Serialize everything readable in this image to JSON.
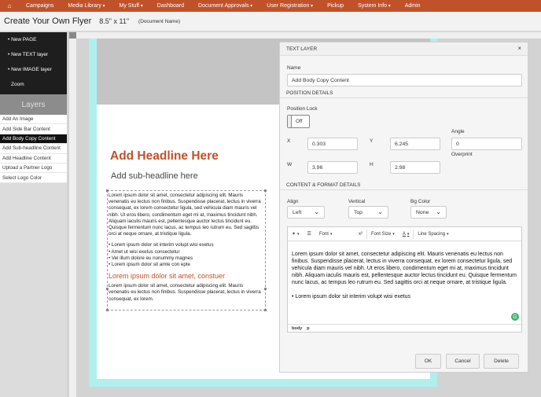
{
  "nav": {
    "home_icon": "⌂",
    "items": [
      "Campaigns",
      "Media Library",
      "My Stuff",
      "Dashboard",
      "Document Approvals",
      "User Registration",
      "Pickup",
      "System Info",
      "Admin"
    ]
  },
  "titlebar": {
    "title": "Create Your Own Flyer",
    "size": "8.5\" x 11\"",
    "docname": "(Document Name)"
  },
  "sidebar": {
    "actions": [
      "• New PAGE",
      "• New TEXT layer",
      "• New IMAGE layer",
      "Zoom"
    ],
    "layers_title": "Layers",
    "layers": [
      "Add An Image",
      "Add Side Bar Content",
      "Add Body Copy Content",
      "Add Sub-headline Content",
      "Add Headline Content",
      "Upload a Partner Logo",
      "Select Logo Color"
    ]
  },
  "canvas": {
    "headline": "Add Headline Here",
    "subheadline": "Add sub-headline here",
    "paragraph1": "Lorem ipsum dolor sit amet, consectetur adipiscing elit. Mauris venenatis eu lectus non finibus. Suspendisse placerat, lectus in viverra consequat, ex lorem consectetur ligula, sed vehicula diam mauris vel nibh. Ut eros libero, condimentum eget mi at, maximus tincidunt nibh. Aliquam iaculis mauris est, pellentesque auctor lectus tincidunt eu. Quisque fermentum nunc lacus, ac tempus leo rutrum eu. Sed sagittis orci at neque ornare, at tristique ligula.",
    "bullets": [
      "Lorem ipsum dolor sit interim volupt wisi exetus",
      "Amet ut wisi exetus consectetur",
      "Vel illum dolore eu nonummy magnes",
      "Lorem ipsum dolor sit amte con epte"
    ],
    "orange_heading": "Lorem ipsum dolor sit amet, constuer",
    "paragraph2": "Lorem ipsum dolor sit amet, consectetur adipiscing elit. Mauris venenatis eu lectus non finibus. Suspendisse placerat, lectus in viverra consequat, ex lorem."
  },
  "panel": {
    "title": "TEXT LAYER",
    "close": "×",
    "name_label": "Name",
    "name_value": "Add Body Copy Content",
    "position_section": "POSITION DETAILS",
    "position_lock_label": "Position Lock",
    "position_lock_value": "Off",
    "x_label": "X",
    "x_value": "0.303",
    "y_label": "Y",
    "y_value": "6.245",
    "angle_label": "Angle",
    "angle_value": "0",
    "overprint_label": "Overprint",
    "w_label": "W",
    "w_value": "3.96",
    "h_label": "H",
    "h_value": "2.98",
    "content_section": "CONTENT & FORMAT DETAILS",
    "align_label": "Align",
    "align_value": "Left",
    "vertical_label": "Vertical",
    "vertical_value": "Top",
    "bgcolor_label": "Bg Color",
    "bgcolor_value": "None",
    "toolbar": {
      "styles": "✶",
      "list": "☰",
      "font": "Font",
      "superscript": "x²",
      "font_size": "Font Size",
      "text_color": "A",
      "line_spacing": "Line Spacing"
    },
    "editor_text": "Lorem ipsum dolor sit amet, consectetur adipiscing elit. Mauris venenatis eu lectus non finibus. Suspendisse placerat, lectus in viverra consequat, ex lorem consectetur ligula, sed vehicula diam mauris vel nibh. Ut eros libero, condimentum eget mi at, maximus tincidunt nibh. Aliquam iaculis mauris est, pellentesque auctor lectus tincidunt eu. Quisque fermentum nunc lacus, ac tempus leo rutrum eu. Sed sagittis orci at neque ornare, at tristique ligula.",
    "editor_bullet": "• Lorem ipsum dolor sit interim volupt wisi exetus",
    "editor_path": [
      "body",
      "p"
    ],
    "grammar_icon": "G",
    "ok": "OK",
    "cancel": "Cancel",
    "delete": "Delete"
  },
  "colors": {
    "accent": "#c0522a",
    "bleed": "#aef0ee"
  }
}
